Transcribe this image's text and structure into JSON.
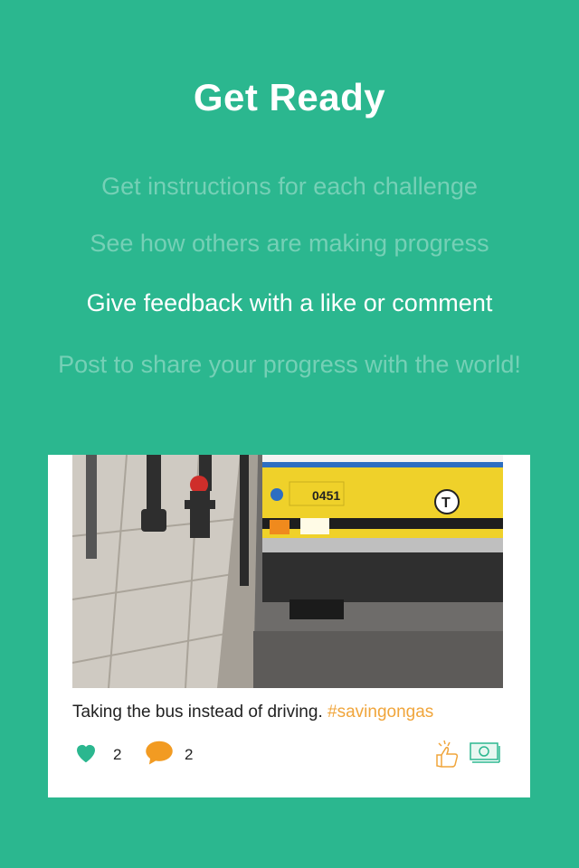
{
  "page": {
    "title": "Get Ready",
    "steps": [
      "Get instructions for each challenge",
      "See how others are making progress",
      "Give feedback with a like or comment",
      "Post to share your progress with the world!"
    ]
  },
  "colors": {
    "background": "#2bb78f",
    "hashtag": "#f0a53b",
    "like": "#2bb78f",
    "comment": "#f29b22"
  },
  "card": {
    "photo": {
      "description_icon": "bus-photo",
      "bus_number": "0451",
      "logo_letter": "T"
    },
    "caption_text": "Taking the bus instead of driving.",
    "caption_hashtag": "#savingongas",
    "likes": "2",
    "comments": "2",
    "icons": [
      "heart-icon",
      "comment-icon",
      "thumbs-up-icon",
      "money-icon"
    ]
  }
}
